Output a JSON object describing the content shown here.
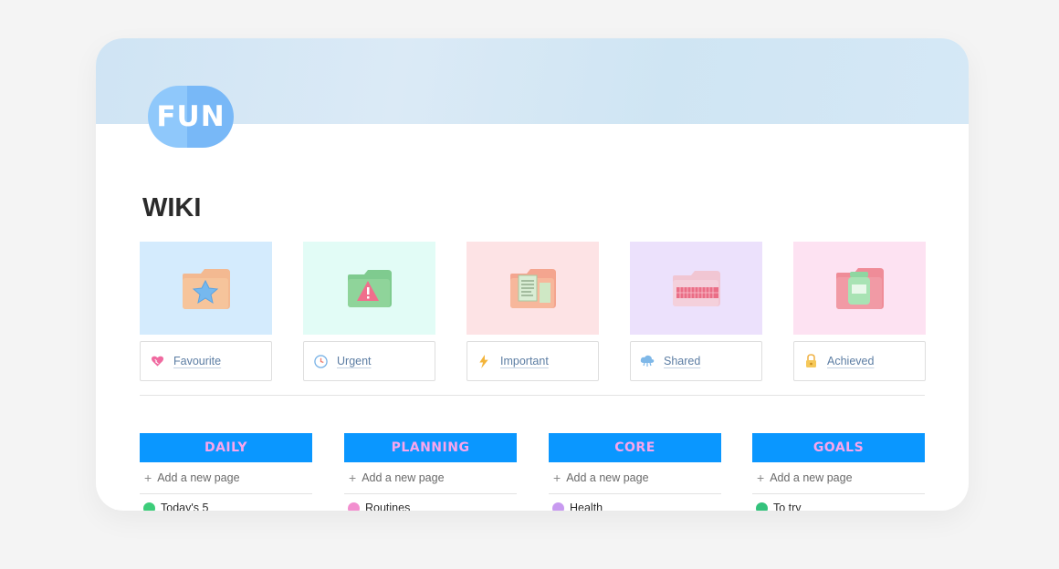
{
  "logo": {
    "text": "FUN"
  },
  "page": {
    "title": "WIKI"
  },
  "gallery": [
    {
      "label": "Favourite",
      "bg": "#d4ebfd",
      "label_icon": "heart-icon",
      "thumb_icon": "star-folder-icon"
    },
    {
      "label": "Urgent",
      "bg": "#e2fcf6",
      "label_icon": "clock-icon",
      "thumb_icon": "warning-folder-icon"
    },
    {
      "label": "Important",
      "bg": "#fde3e5",
      "label_icon": "lightning-icon",
      "thumb_icon": "document-folder-icon"
    },
    {
      "label": "Shared",
      "bg": "#ece1fc",
      "label_icon": "cloud-icon",
      "thumb_icon": "network-folder-icon"
    },
    {
      "label": "Achieved",
      "bg": "#fde2f2",
      "label_icon": "padlock-icon",
      "thumb_icon": "jar-folder-icon"
    }
  ],
  "boards": [
    {
      "title": "DAILY",
      "add_label": "Add a new page",
      "first_item": "Today's 5",
      "item_icon": "checklist-icon",
      "item_color": "#3dcd7a"
    },
    {
      "title": "PLANNING",
      "add_label": "Add a new page",
      "first_item": "Routines",
      "item_icon": "flower-icon",
      "item_color": "#f28fcf"
    },
    {
      "title": "CORE",
      "add_label": "Add a new page",
      "first_item": "Health",
      "item_icon": "heart-hand-icon",
      "item_color": "#c89af0"
    },
    {
      "title": "GOALS",
      "add_label": "Add a new page",
      "first_item": "To try",
      "item_icon": "checkmark-icon",
      "item_color": "#34c27c"
    }
  ],
  "colors": {
    "board_header": "#0a97ff",
    "board_title": "#f8a5ec",
    "link_text": "#5c7da3"
  }
}
